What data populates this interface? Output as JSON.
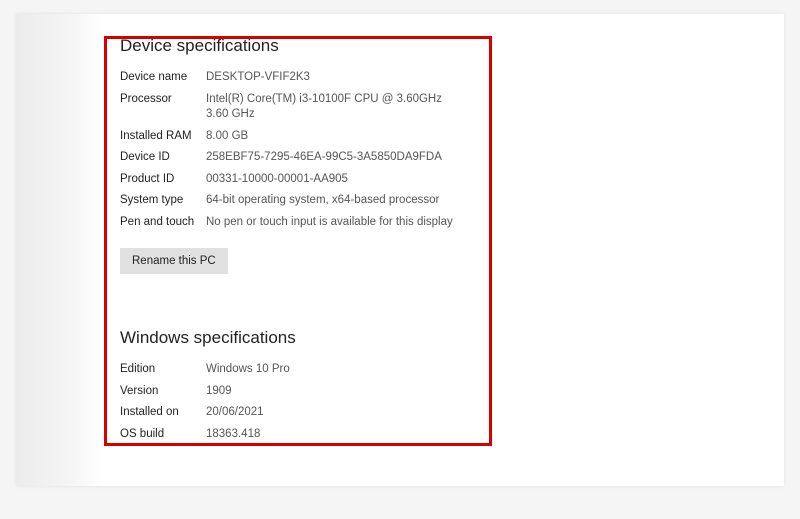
{
  "device": {
    "title": "Device specifications",
    "rows": {
      "deviceName": {
        "label": "Device name",
        "value": "DESKTOP-VFIF2K3"
      },
      "processor": {
        "label": "Processor",
        "value": "Intel(R) Core(TM) i3-10100F CPU @ 3.60GHz   3.60 GHz"
      },
      "installedRam": {
        "label": "Installed RAM",
        "value": "8.00 GB"
      },
      "deviceId": {
        "label": "Device ID",
        "value": "258EBF75-7295-46EA-99C5-3A5850DA9FDA"
      },
      "productId": {
        "label": "Product ID",
        "value": "00331-10000-00001-AA905"
      },
      "systemType": {
        "label": "System type",
        "value": "64-bit operating system, x64-based processor"
      },
      "penTouch": {
        "label": "Pen and touch",
        "value": "No pen or touch input is available for this display"
      }
    },
    "renameButton": "Rename this PC"
  },
  "windows": {
    "title": "Windows specifications",
    "rows": {
      "edition": {
        "label": "Edition",
        "value": "Windows 10 Pro"
      },
      "version": {
        "label": "Version",
        "value": "1909"
      },
      "installedOn": {
        "label": "Installed on",
        "value": "20/06/2021"
      },
      "osBuild": {
        "label": "OS build",
        "value": "18363.418"
      }
    }
  }
}
